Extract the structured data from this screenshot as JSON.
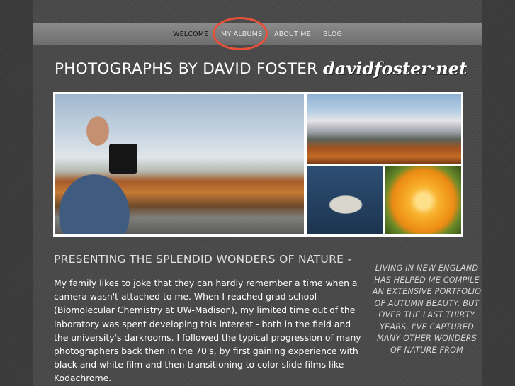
{
  "nav": {
    "items": [
      {
        "label": "WELCOME",
        "active": true
      },
      {
        "label": "MY ALBUMS",
        "active": false
      },
      {
        "label": "ABOUT ME",
        "active": false
      },
      {
        "label": "BLOG",
        "active": false
      }
    ]
  },
  "header": {
    "title": "PHOTOGRAPHS BY DAVID FOSTER",
    "domain": "davidfoster·net"
  },
  "main": {
    "heading": "PRESENTING THE SPLENDID WONDERS OF NATURE -",
    "paragraph": "My family likes to joke that they can hardly remember a time when a camera wasn't attached to me. When I reached grad school (Biomolecular Chemistry at UW-Madison), my limited time out of the laboratory was spent developing this interest - both in the field and the university's darkrooms. I followed the typical progression of many photographers back then in the 70's, by first gaining experience with black and white film and then transitioning to color slide films like Kodachrome."
  },
  "sidebar": {
    "quote": "LIVING IN NEW ENGLAND HAS HELPED ME COMPILE AN EXTENSIVE PORTFOLIO OF AUTUMN BEAUTY. BUT OVER THE LAST THIRTY YEARS, I'VE CAPTURED MANY OTHER WONDERS OF NATURE FROM"
  },
  "colors": {
    "highlight": "#e8503a",
    "background": "#3b3b3b"
  }
}
